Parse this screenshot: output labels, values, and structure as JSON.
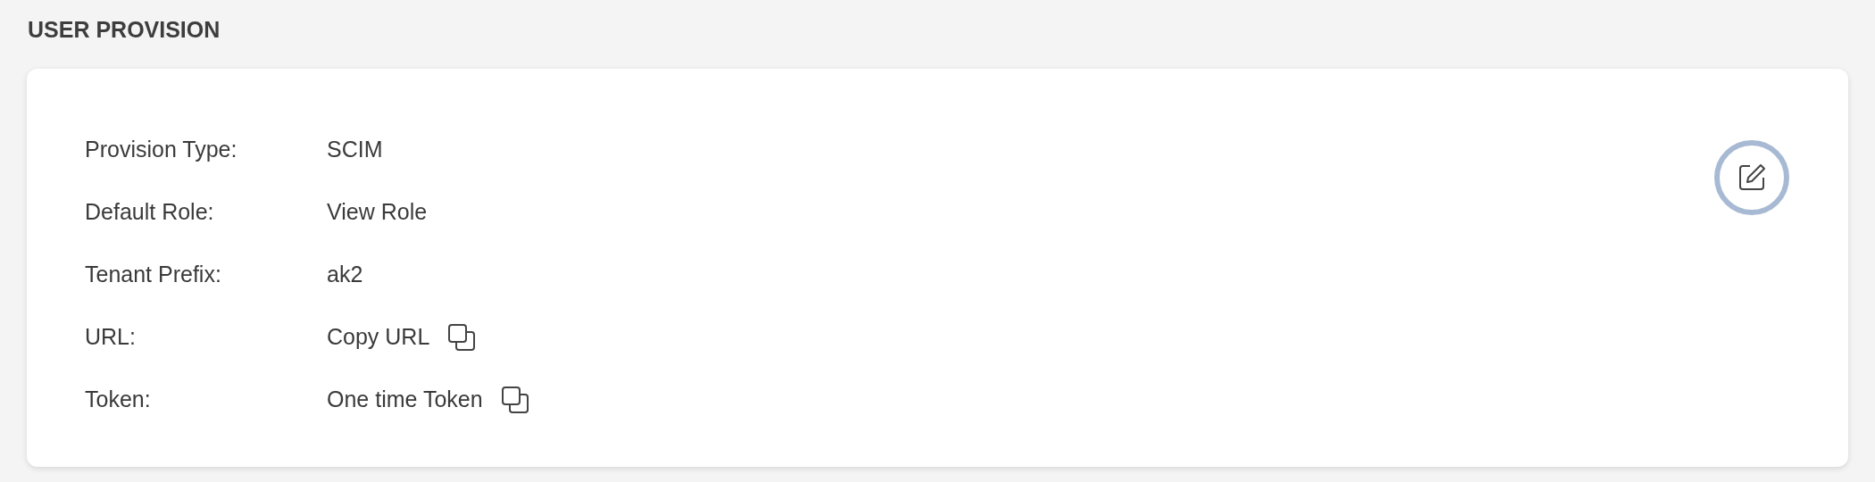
{
  "section_title": "USER PROVISION",
  "fields": [
    {
      "label": "Provision Type:",
      "value": "SCIM",
      "kind": "text"
    },
    {
      "label": "Default Role:",
      "value": "View Role",
      "kind": "text"
    },
    {
      "label": "Tenant Prefix:",
      "value": "ak2",
      "kind": "text"
    },
    {
      "label": "URL:",
      "value": "Copy URL",
      "kind": "copy"
    },
    {
      "label": "Token:",
      "value": "One time Token",
      "kind": "copy"
    }
  ]
}
